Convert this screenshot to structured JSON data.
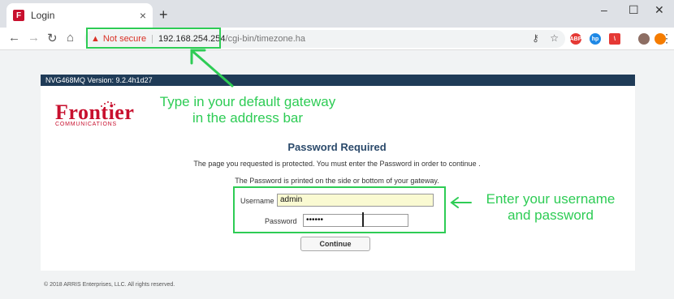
{
  "browser": {
    "tab_title": "Login",
    "tab_favicon_letter": "F",
    "new_tab_symbol": "+",
    "close_symbol": "×",
    "minimize_symbol": "–",
    "maximize_symbol": "☐",
    "window_close_symbol": "✕"
  },
  "toolbar": {
    "back_symbol": "←",
    "forward_symbol": "→",
    "reload_symbol": "↻",
    "home_symbol": "⌂",
    "security_label": "Not secure",
    "url_host": "192.168.254.254",
    "url_path": "/cgi-bin/timezone.ha",
    "key_symbol": "⚷",
    "star_symbol": "☆",
    "menu_symbol": "⋮",
    "extensions": [
      {
        "name": "adblock-icon",
        "text": "ABP",
        "color": "#e53935"
      },
      {
        "name": "hp-icon",
        "text": "hp",
        "color": "#1e88e5"
      },
      {
        "name": "pdf-icon",
        "text": "\\",
        "color": "#e53935"
      },
      {
        "name": "photo-icon",
        "text": "",
        "color": "#8d6e63"
      },
      {
        "name": "profile-icon",
        "text": "",
        "color": "#f57c00"
      }
    ]
  },
  "page": {
    "version": "NVG468MQ Version: 9.2.4h1d27",
    "logo_main": "Frontier",
    "logo_sub": "COMMUNICATIONS",
    "title": "Password Required",
    "message1": "The page you requested is protected. You must enter the Password in order to continue .",
    "message2": "The Password is printed on the side or bottom of your gateway.",
    "username_label": "Username",
    "username_value": "admin",
    "password_label": "Password",
    "password_value": "••••••",
    "continue_label": "Continue",
    "footer": "© 2018 ARRIS Enterprises, LLC. All rights reserved."
  },
  "annotations": {
    "gateway_line1": "Type in your default gateway",
    "gateway_line2": "in the address bar",
    "credentials_line1": "Enter your username",
    "credentials_line2": "and password"
  },
  "colors": {
    "accent_green": "#2ecc55",
    "frontier_red": "#c8102e",
    "header_navy": "#1f3b57",
    "warning_red": "#d93025"
  }
}
